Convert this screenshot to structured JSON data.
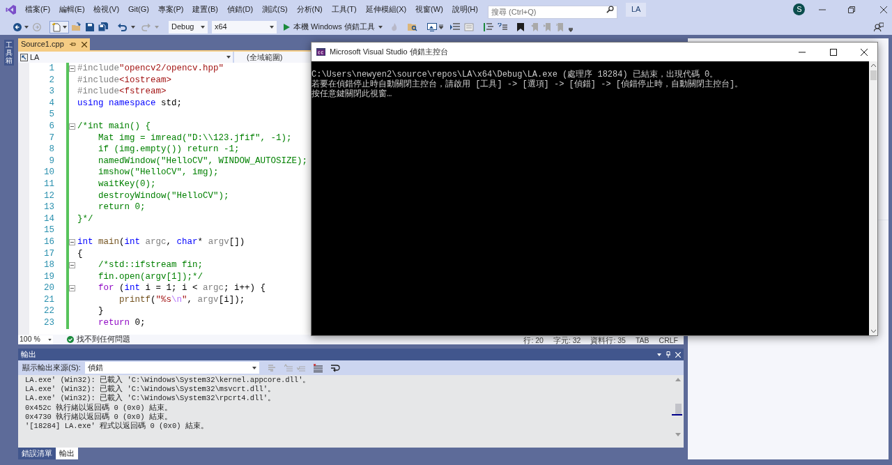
{
  "menu": [
    "檔案(F)",
    "編輯(E)",
    "檢視(V)",
    "Git(G)",
    "專案(P)",
    "建置(B)",
    "偵錯(D)",
    "測試(S)",
    "分析(N)",
    "工具(T)",
    "延伸模組(X)",
    "視窗(W)",
    "說明(H)"
  ],
  "search": {
    "placeholder": "搜尋 (Ctrl+Q)"
  },
  "solution_name": "LA",
  "account_initial": "S",
  "toolbar": {
    "configuration": "Debug",
    "platform": "x64",
    "run_label": "本機 Windows 偵錯工具"
  },
  "side_tab": "工具箱",
  "editor": {
    "tab": {
      "label": "Source1.cpp",
      "selected": true
    },
    "nav_scope": "LA",
    "nav_function": "(全域範圍)",
    "lines": [
      {
        "number": "1",
        "fold": true,
        "tokens": [
          {
            "kind": "pre",
            "text": "#include"
          },
          {
            "kind": "str",
            "text": "\"opencv2/opencv.hpp\""
          }
        ]
      },
      {
        "number": "2",
        "fold": false,
        "tokens": [
          {
            "kind": "pre",
            "text": "#include"
          },
          {
            "kind": "str",
            "text": "<iostream>"
          }
        ]
      },
      {
        "number": "3",
        "fold": false,
        "tokens": [
          {
            "kind": "pre",
            "text": "#include"
          },
          {
            "kind": "str",
            "text": "<fstream>"
          }
        ]
      },
      {
        "number": "4",
        "fold": false,
        "tokens": [
          {
            "kind": "kw",
            "text": "using"
          },
          {
            "kind": "kw",
            "text": " namespace"
          },
          {
            "kind": "plain",
            "text": " std;"
          }
        ]
      },
      {
        "number": "5",
        "fold": false
      },
      {
        "number": "6",
        "fold": true,
        "tokens": [
          {
            "kind": "comment",
            "text": "/*int main() {"
          }
        ]
      },
      {
        "number": "7",
        "fold": false,
        "tokens": [
          {
            "kind": "comment",
            "text": "    Mat img = imread(\"D:\\\\123.jfif\", -1);"
          }
        ]
      },
      {
        "number": "8",
        "fold": false,
        "tokens": [
          {
            "kind": "comment",
            "text": "    if (img.empty()) return -1;"
          }
        ]
      },
      {
        "number": "9",
        "fold": false,
        "tokens": [
          {
            "kind": "comment",
            "text": "    namedWindow(\"HelloCV\", WINDOW_AUTOSIZE);"
          }
        ]
      },
      {
        "number": "10",
        "fold": false,
        "tokens": [
          {
            "kind": "comment",
            "text": "    imshow(\"HelloCV\", img);"
          }
        ]
      },
      {
        "number": "11",
        "fold": false,
        "tokens": [
          {
            "kind": "comment",
            "text": "    waitKey(0);"
          }
        ]
      },
      {
        "number": "12",
        "fold": false,
        "tokens": [
          {
            "kind": "comment",
            "text": "    destroyWindow(\"HelloCV\");"
          }
        ]
      },
      {
        "number": "13",
        "fold": false,
        "tokens": [
          {
            "kind": "comment",
            "text": "    return 0;"
          }
        ]
      },
      {
        "number": "14",
        "fold": false,
        "tokens": [
          {
            "kind": "comment",
            "text": "}*/"
          }
        ]
      },
      {
        "number": "15",
        "fold": false
      },
      {
        "number": "16",
        "fold": true,
        "tokens": [
          {
            "kind": "kw",
            "text": "int"
          },
          {
            "kind": "func",
            "text": " main"
          },
          {
            "kind": "plain",
            "text": "("
          },
          {
            "kind": "kw",
            "text": "int"
          },
          {
            "kind": "param",
            "text": " argc"
          },
          {
            "kind": "plain",
            "text": ", "
          },
          {
            "kind": "kw",
            "text": "char"
          },
          {
            "kind": "plain",
            "text": "* "
          },
          {
            "kind": "param",
            "text": "argv"
          },
          {
            "kind": "plain",
            "text": "[])"
          }
        ]
      },
      {
        "number": "17",
        "fold": false,
        "tokens": [
          {
            "kind": "plain",
            "text": "{"
          }
        ]
      },
      {
        "number": "18",
        "fold": true,
        "tokens": [
          {
            "kind": "comment",
            "text": "    /*std::ifstream fin;"
          }
        ]
      },
      {
        "number": "19",
        "fold": false,
        "tokens": [
          {
            "kind": "comment",
            "text": "    fin.open(argv[1]);*/"
          }
        ]
      },
      {
        "number": "20",
        "fold": true,
        "tokens": [
          {
            "kind": "ctrl",
            "text": "    for"
          },
          {
            "kind": "plain",
            "text": " ("
          },
          {
            "kind": "kw",
            "text": "int"
          },
          {
            "kind": "plain",
            "text": " i = 1; i < "
          },
          {
            "kind": "param",
            "text": "argc"
          },
          {
            "kind": "plain",
            "text": "; i++) {"
          }
        ]
      },
      {
        "number": "21",
        "fold": false,
        "tokens": [
          {
            "kind": "func",
            "text": "        printf"
          },
          {
            "kind": "plain",
            "text": "("
          },
          {
            "kind": "str",
            "text": "\"%s"
          },
          {
            "kind": "esc",
            "text": "\\n"
          },
          {
            "kind": "str",
            "text": "\""
          },
          {
            "kind": "plain",
            "text": ", "
          },
          {
            "kind": "param",
            "text": "argv"
          },
          {
            "kind": "plain",
            "text": "[i]);"
          }
        ]
      },
      {
        "number": "22",
        "fold": false,
        "tokens": [
          {
            "kind": "plain",
            "text": "    }"
          }
        ]
      },
      {
        "number": "23",
        "fold": false,
        "tokens": [
          {
            "kind": "ctrl",
            "text": "    return"
          },
          {
            "kind": "plain",
            "text": " 0;"
          }
        ]
      }
    ],
    "zoom": "100 %",
    "issues": "找不到任何問題",
    "status": [
      "行: 20",
      "字元: 32",
      "資料行: 35",
      "TAB",
      "CRLF"
    ]
  },
  "console": {
    "title": "Microsoft Visual Studio 偵錯主控台",
    "lines": [
      "C:\\Users\\newyen2\\source\\repos\\LA\\x64\\Debug\\LA.exe (處理序 18284) 已結束，出現代碼 0。",
      "若要在偵錯停止時自動關閉主控台，請啟用 [工具] -> [選項] -> [偵錯] -> [偵錯停止時，自動關閉主控台]。",
      "按任意鍵關閉此視窗…"
    ]
  },
  "output": {
    "title": "輸出",
    "source_label": "顯示輸出來源(S):",
    "source": "偵錯",
    "lines": [
      "LA.exe' (Win32): 已載入 'C:\\Windows\\System32\\kernel.appcore.dll'。",
      "LA.exe' (Win32): 已載入 'C:\\Windows\\System32\\msvcrt.dll'。",
      "LA.exe' (Win32): 已載入 'C:\\Windows\\System32\\rpcrt4.dll'。",
      "0x452c 執行緒以返回碼 0 (0x0) 結束。",
      "0x4730 執行緒以返回碼 0 (0x0) 結束。",
      "'[18284] LA.exe' 程式以返回碼 0 (0x0) 結束。"
    ]
  },
  "bottom_tabs": [
    {
      "label": "錯誤清單",
      "selected": false
    },
    {
      "label": "輸出",
      "selected": true
    }
  ]
}
